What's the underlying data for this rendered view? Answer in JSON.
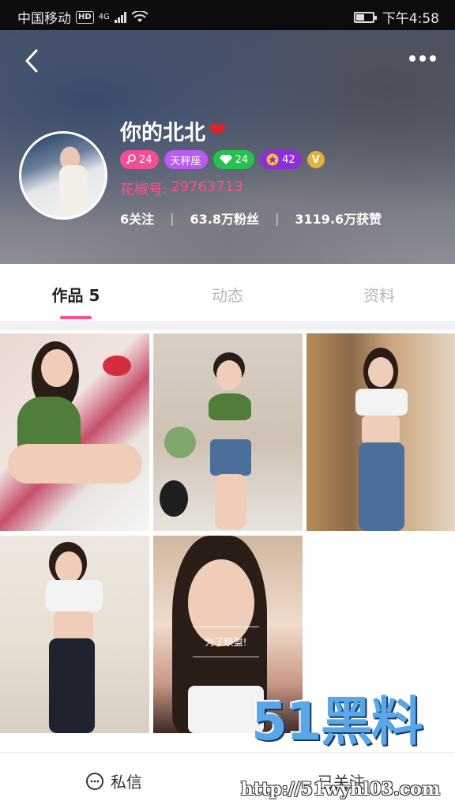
{
  "status_bar": {
    "carrier": "中国移动",
    "hd": "HD",
    "network": "4G",
    "time": "下午4:58"
  },
  "header": {
    "nickname": "你的北北",
    "heart": "❤",
    "badges": {
      "gender_age": "24",
      "zodiac": "天秤座",
      "diamond_level": "24",
      "star_level": "42",
      "verified": "V"
    },
    "id_label": "花椒号:",
    "id_value": "29763713",
    "stats": {
      "following": "6关注",
      "fans": "63.8万粉丝",
      "likes": "3119.6万获赞"
    }
  },
  "tabs": [
    {
      "label": "作品 5",
      "active": true
    },
    {
      "label": "动态",
      "active": false
    },
    {
      "label": "资料",
      "active": false
    }
  ],
  "grid": {
    "caption_5": "为了联盟!"
  },
  "bottom_bar": {
    "message_label": "私信",
    "follow_label": "已关注"
  },
  "watermark": {
    "brand": "51黑料",
    "url": "http://51wyhl03.com"
  }
}
